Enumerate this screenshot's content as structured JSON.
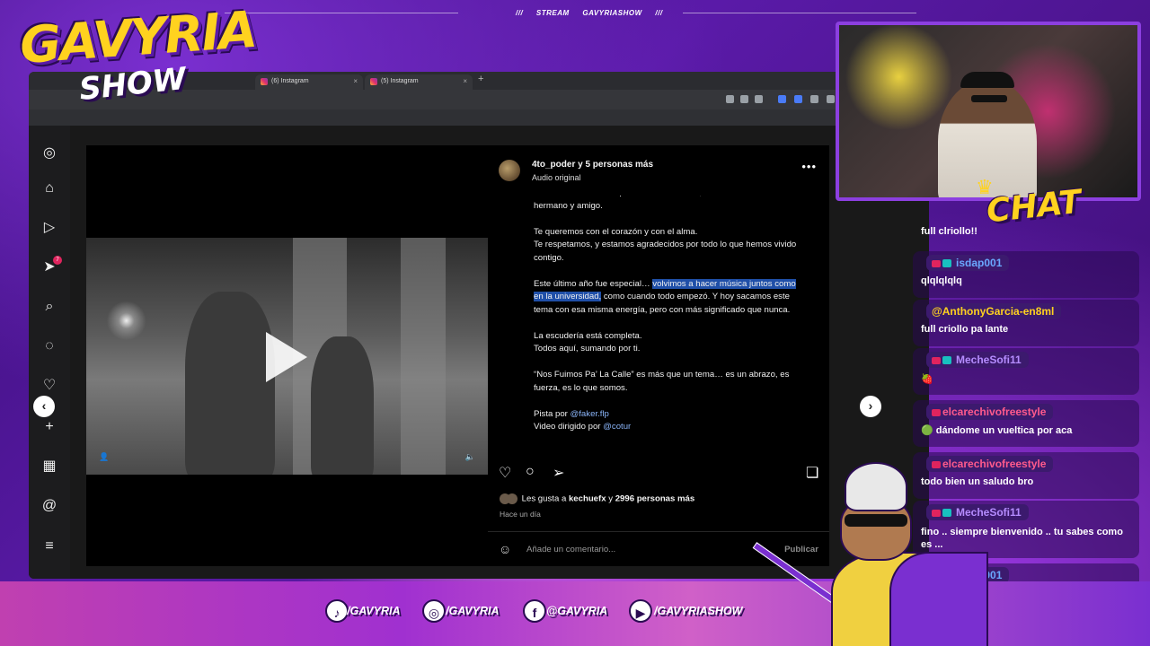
{
  "overlay": {
    "stream_tag_prefix": "///",
    "stream_label": "STREAM",
    "channel_label": "GAVYRIASHOW",
    "stream_tag_suffix": "///",
    "logo_line1": "GAVYRIA",
    "logo_line2": "SHOW"
  },
  "browser": {
    "tabs": [
      {
        "label": "(6) Instagram",
        "close": "×"
      },
      {
        "label": "(5) Instagram",
        "close": "×"
      }
    ],
    "new_tab": "+"
  },
  "post": {
    "author": "4to_poder y 5 personas más",
    "audio": "Audio original",
    "more": "•••",
    "caption_partial_line": "como Cuarto Poder… pero más allá de eso, en nuestras vidas como hermano y amigo.",
    "caption_p1": "Te queremos con el corazón y con el alma.",
    "caption_p1b": "Te respetamos, y estamos agradecidos por todo lo que hemos vivido contigo.",
    "caption_p2_start": "Este último año fue especial… ",
    "caption_p2_highlight": "volvimos a hacer música juntos como en la universidad,",
    "caption_p2_end": " como cuando todo empezó. Y hoy sacamos este tema con esa misma energía, pero con más significado que nunca.",
    "caption_p3a": "La escudería está completa.",
    "caption_p3b": "Todos aquí, sumando por ti.",
    "caption_p4": "“Nos Fuimos Pa’ La Calle” es más que un tema… es un abrazo, es fuerza, es lo que somos.",
    "caption_pista_prefix": "Pista por ",
    "caption_pista_link": "@faker.flp",
    "caption_video_prefix": "Video dirigido por ",
    "caption_video_link": "@cotur",
    "likes_prefix": "Les gusta a ",
    "likes_user": "kechuefx",
    "likes_mid": " y ",
    "likes_count": "2996 personas más",
    "date": "Hace un día",
    "comment_placeholder": "Añade un comentario...",
    "publish": "Publicar"
  },
  "sidebar_badge": "7",
  "chat": {
    "title": "CHAT",
    "messages": [
      {
        "user": "",
        "text": "full clriollo!!"
      },
      {
        "user": "isdap001",
        "text": "qlqlqlqlq"
      },
      {
        "user": "@AnthonyGarcia-en8ml",
        "text": "full criollo pa lante"
      },
      {
        "user": "MecheSofi11",
        "text": "🍓"
      },
      {
        "user": "elcarechivofreestyle",
        "text": "dándome un vueltica por aca"
      },
      {
        "user": "elcarechivofreestyle",
        "text": "todo bien un saludo bro"
      },
      {
        "user": "MecheSofi11",
        "text": "fino .. siempre bienvenido .. tu sabes como es ..."
      },
      {
        "user": "isdap001",
        "text": "👏👏👏"
      }
    ],
    "colors": {
      "isdap001": "#6aa8ff",
      "@AnthonyGarcia-en8ml": "#ffd21f",
      "MecheSofi11": "#b58cff",
      "elcarechivofreestyle": "#ff5a8c"
    }
  },
  "socials": [
    {
      "icon": "♪",
      "handle": "/GAVYRIA"
    },
    {
      "icon": "◎",
      "handle": "/GAVYRIA"
    },
    {
      "icon": "f",
      "handle": "@GAVYRIA"
    },
    {
      "icon": "▶",
      "handle": "/GAVYRIASHOW"
    }
  ]
}
